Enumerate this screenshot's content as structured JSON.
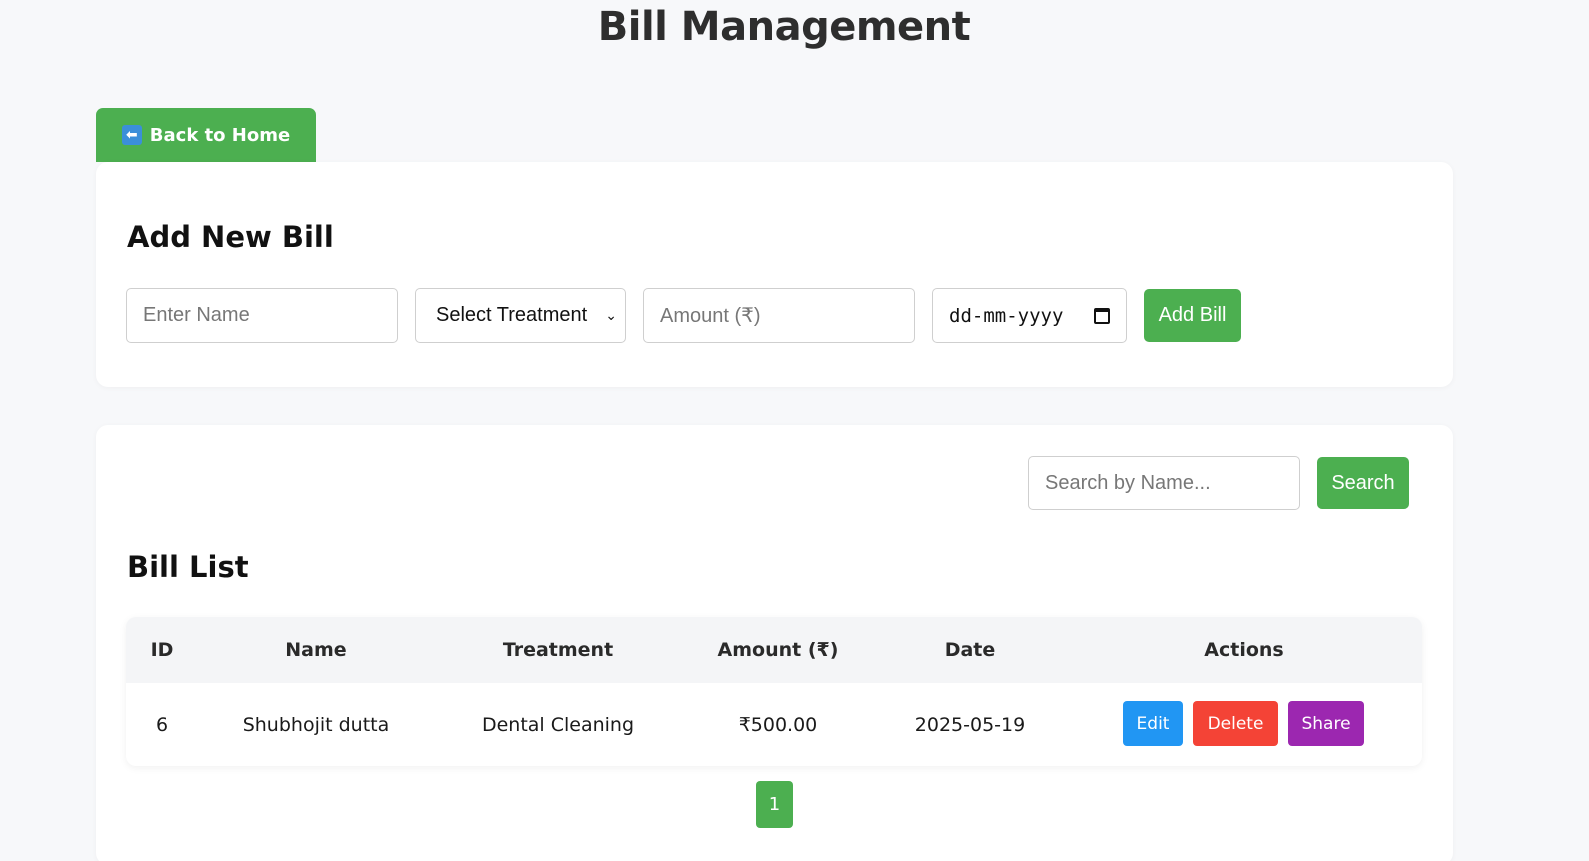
{
  "page": {
    "title": "Bill Management"
  },
  "nav": {
    "back_label": "Back to Home",
    "back_icon": "left-arrow-icon"
  },
  "add_bill": {
    "heading": "Add New Bill",
    "name_placeholder": "Enter Name",
    "treatment_selected": "Select Treatment",
    "amount_placeholder": "Amount (₹)",
    "date_placeholder": "dd-mm-yyyy",
    "submit_label": "Add Bill"
  },
  "search": {
    "placeholder": "Search by Name...",
    "button_label": "Search"
  },
  "bill_list": {
    "heading": "Bill List",
    "columns": [
      "ID",
      "Name",
      "Treatment",
      "Amount (₹)",
      "Date",
      "Actions"
    ],
    "rows": [
      {
        "id": "6",
        "name": "Shubhojit dutta",
        "treatment": "Dental Cleaning",
        "amount": "₹500.00",
        "date": "2025-05-19"
      }
    ],
    "actions": {
      "edit": "Edit",
      "delete": "Delete",
      "share": "Share"
    }
  },
  "pagination": {
    "current": "1"
  },
  "colors": {
    "primary_green": "#4caf50",
    "edit_blue": "#2196f3",
    "delete_red": "#f44336",
    "share_purple": "#9c27b0"
  }
}
